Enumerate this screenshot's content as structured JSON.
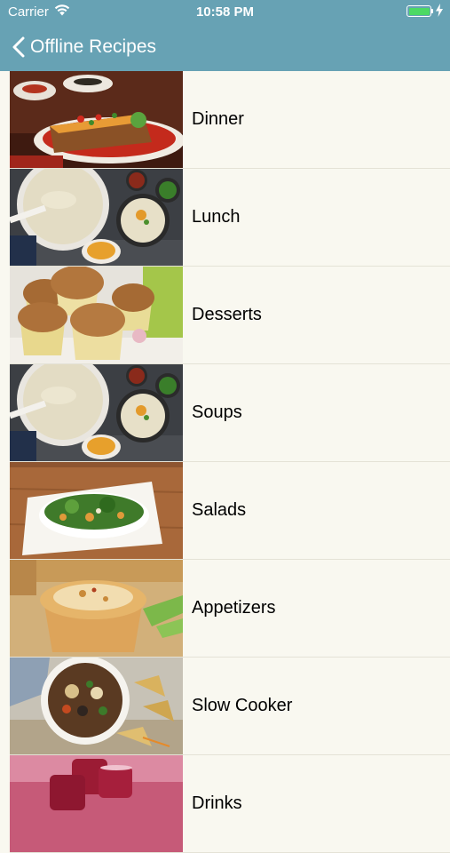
{
  "status": {
    "carrier": "Carrier",
    "time": "10:58 PM"
  },
  "nav": {
    "back_label": "Offline Recipes"
  },
  "categories": [
    {
      "label": "Dinner",
      "image": "dinner-casserole-image"
    },
    {
      "label": "Lunch",
      "image": "potato-soup-image"
    },
    {
      "label": "Desserts",
      "image": "muffins-image"
    },
    {
      "label": "Soups",
      "image": "potato-soup-image"
    },
    {
      "label": "Salads",
      "image": "spinach-salad-image"
    },
    {
      "label": "Appetizers",
      "image": "cheese-cups-image"
    },
    {
      "label": "Slow Cooker",
      "image": "chili-bowl-image"
    },
    {
      "label": "Drinks",
      "image": "red-drinks-image"
    }
  ],
  "colors": {
    "header": "#67a2b4",
    "background": "#f9f8f0",
    "battery": "#4cd964"
  }
}
